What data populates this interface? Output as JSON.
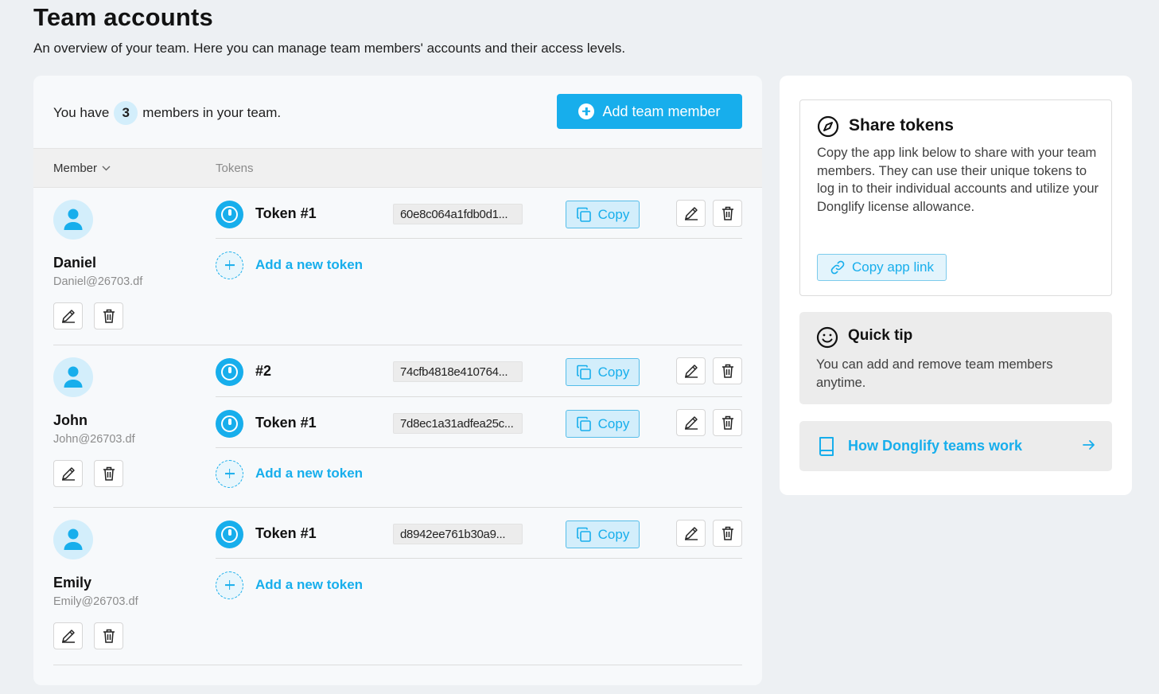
{
  "page": {
    "title": "Team accounts",
    "subtitle": "An overview of your team. Here you can manage team members' accounts and their access levels."
  },
  "summary": {
    "prefix": "You have",
    "count": "3",
    "suffix": "members in your team.",
    "add_member_label": "Add team member"
  },
  "table": {
    "member_col": "Member",
    "tokens_col": "Tokens"
  },
  "members": [
    {
      "name": "Daniel",
      "email": "Daniel@26703.df",
      "tokens": [
        {
          "name": "Token #1",
          "value": "60e8c064a1fdb0d1..."
        }
      ]
    },
    {
      "name": "John",
      "email": "John@26703.df",
      "tokens": [
        {
          "name": "#2",
          "value": "74cfb4818e410764..."
        },
        {
          "name": "Token #1",
          "value": "7d8ec1a31adfea25c..."
        }
      ]
    },
    {
      "name": "Emily",
      "email": "Emily@26703.df",
      "tokens": [
        {
          "name": "Token #1",
          "value": "d8942ee761b30a9..."
        }
      ]
    }
  ],
  "labels": {
    "copy": "Copy",
    "add_token": "Add a new token"
  },
  "share": {
    "title": "Share tokens",
    "description": "Copy the app link below to share with your team members. They can use their unique tokens to log in to their individual accounts and utilize your Donglify license allowance.",
    "button": "Copy app link"
  },
  "tip": {
    "title": "Quick tip",
    "text": "You can add and remove team members anytime."
  },
  "how": {
    "label": "How Donglify teams work"
  },
  "colors": {
    "accent": "#17aeec",
    "accent_light": "#d3eefb",
    "background": "#edf0f3"
  }
}
